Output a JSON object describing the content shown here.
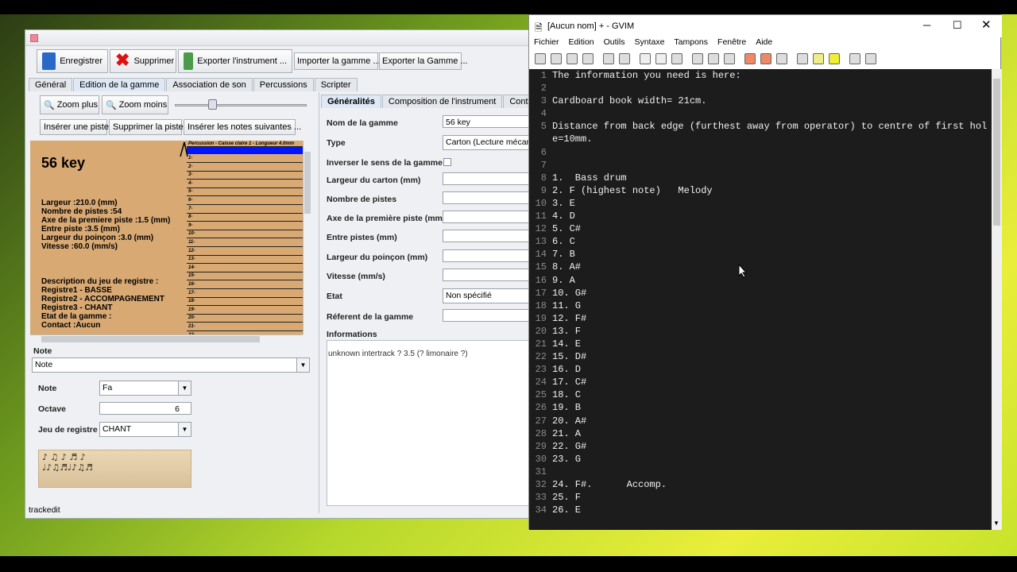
{
  "java": {
    "toolbar": {
      "save": "Enregistrer",
      "delete": "Supprimer",
      "export_instrument": "Exporter l'instrument ...",
      "import_scale": "Importer la gamme ...",
      "export_scale": "Exporter la Gamme ..."
    },
    "tabs": [
      "Général",
      "Edition de la gamme",
      "Association de son",
      "Percussions",
      "Scripter"
    ],
    "zoom_in": "Zoom plus",
    "zoom_out": "Zoom moins",
    "insert_track": "Insérer une piste",
    "delete_track": "Supprimer la piste",
    "insert_notes": "Insérer les notes suivantes ...",
    "scale_title": "56 key",
    "specs": [
      "Largeur :210.0 (mm)",
      "Nombre de pistes :54",
      "Axe de la premiere piste :1.5 (mm)",
      "Entre piste :3.5 (mm)",
      "Largeur du poinçon :3.0 (mm)",
      "Vitesse :60.0 (mm/s)"
    ],
    "registers": [
      "Description du jeu de registre :",
      "Registre1 - BASSE",
      "Registre2 - ACCOMPAGNEMENT",
      "Registre3 - CHANT",
      "Etat de la gamme :",
      "Contact :Aucun"
    ],
    "track_header": "Percussion - Caisse claire 1 - Longueur 4.0mm",
    "track_numbers": [
      "1-",
      "2-",
      "3-",
      "4-",
      "5-",
      "6-",
      "7-",
      "8-",
      "9-",
      "10-",
      "11-",
      "12-",
      "13-",
      "14-",
      "15-",
      "16-",
      "17-",
      "18-",
      "19-",
      "20-",
      "21-",
      "22-",
      "23-"
    ],
    "note_section": "Note",
    "note_combo": "Note",
    "note_label": "Note",
    "note_value": "Fa",
    "octave_label": "Octave",
    "octave_value": "6",
    "register_label": "Jeu de registre",
    "register_value": "CHANT",
    "status": "trackedit",
    "sub_tabs": [
      "Généralités",
      "Composition de l'instrument",
      "Contra"
    ],
    "props": [
      {
        "label": "Nom de la gamme",
        "value": "56 key"
      },
      {
        "label": "Type",
        "value": "Carton (Lecture mécan"
      },
      {
        "label": "Inverser le sens de la gamme",
        "value": ""
      },
      {
        "label": "Largeur du carton (mm)",
        "value": ""
      },
      {
        "label": "Nombre de pistes",
        "value": ""
      },
      {
        "label": "Axe de la première piste (mm)",
        "value": ""
      },
      {
        "label": "Entre pistes (mm)",
        "value": ""
      },
      {
        "label": "Largeur du poinçon (mm)",
        "value": ""
      },
      {
        "label": "Vitesse (mm/s)",
        "value": ""
      },
      {
        "label": "Etat",
        "value": "Non spécifié"
      },
      {
        "label": "Réferent de la gamme",
        "value": ""
      }
    ],
    "info_label": "Informations",
    "info_text": "unknown intertrack ? 3.5 (? limonaire ?)"
  },
  "gvim": {
    "title": "[Aucun nom] + - GVIM",
    "menu": [
      "Fichier",
      "Edition",
      "Outils",
      "Syntaxe",
      "Tampons",
      "Fenêtre",
      "Aide"
    ],
    "lines": [
      "The information you need is here:",
      "",
      "Cardboard book width= 21cm.",
      "",
      "Distance from back edge (furthest away from operator) to centre of first hol",
      "e=10mm.",
      "",
      "",
      "1.  Bass drum",
      "2. F (highest note)   Melody",
      "3. E",
      "4. D",
      "5. C#",
      "6. C",
      "7. B",
      "8. A#",
      "9. A",
      "10. G#",
      "11. G",
      "12. F#",
      "13. F",
      "14. E",
      "15. D#",
      "16. D",
      "17. C#",
      "18. C",
      "19. B",
      "20. A#",
      "21. A",
      "22. G#",
      "23. G",
      "",
      "24. F#.      Accomp.",
      "25. F",
      "26. E"
    ],
    "line_numbers": [
      "1",
      "2",
      "3",
      "4",
      "5",
      "",
      "6",
      "7",
      "8",
      "9",
      "10",
      "11",
      "12",
      "13",
      "14",
      "15",
      "16",
      "17",
      "18",
      "19",
      "20",
      "21",
      "22",
      "23",
      "24",
      "25",
      "26",
      "27",
      "28",
      "29",
      "30",
      "31",
      "32",
      "33",
      "34"
    ]
  }
}
